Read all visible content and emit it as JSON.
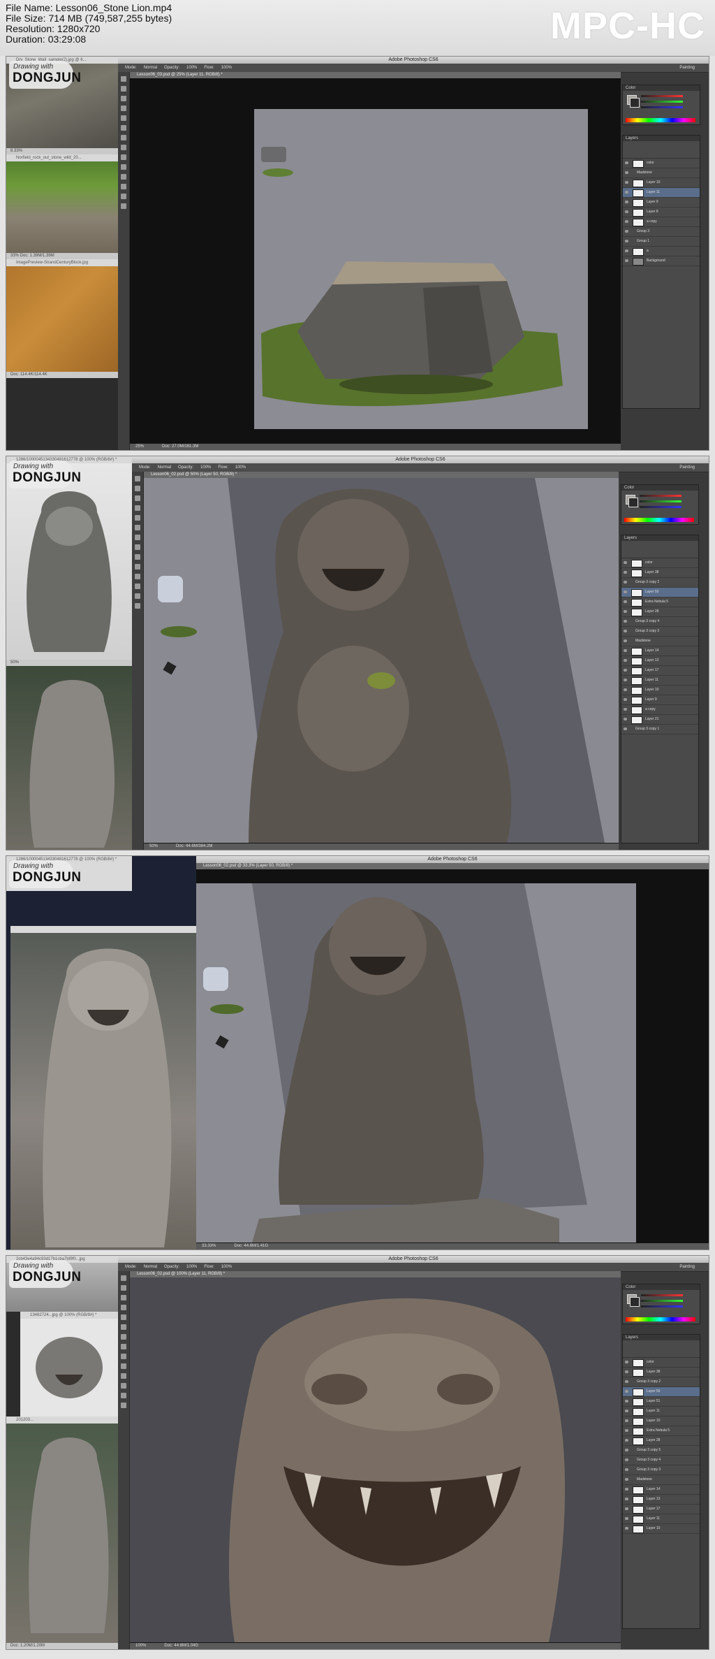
{
  "header": {
    "file_name_line": "File Name: Lesson06_Stone Lion.mp4",
    "file_size_line": "File Size: 714 MB (749,587,255 bytes)",
    "resolution_line": "Resolution: 1280x720",
    "duration_line": "Duration: 03:29:08",
    "player_logo": "MPC-HC"
  },
  "app": {
    "title": "Adobe Photoshop CS6",
    "workspace": "Painting",
    "options": [
      "Mode:",
      "Normal",
      "Opacity:",
      "100%",
      "Flow:",
      "100%"
    ]
  },
  "badge": {
    "script": "Drawing with",
    "name": "DONGJUN"
  },
  "frames": [
    {
      "doc_tab": "Lesson06_03.psd @ 25% (Layer 11, RGB/8) *",
      "zoom": "25%",
      "doc_size": "Doc: 27.0M/161.3M",
      "refs": [
        {
          "tab": "Dry_Stone_Wall_sample(2).jpg @ 6...",
          "status": "8.33%"
        },
        {
          "tab": "Norfield_rock_out_stone_wild_20...",
          "status": "33%   Doc: 1.39M/1.39M"
        },
        {
          "tab": "ImagePreview-StrandCenturyBlock.jpg",
          "status": "Doc: 114.4K/114.4K"
        }
      ],
      "layers": [
        "color",
        "Madstone",
        "Layer 10",
        "Layer 11",
        "Layer 9",
        "Layer 8",
        "a copy",
        "Group 3",
        "Group 1",
        "a",
        "Background"
      ]
    },
    {
      "doc_tab": "Lesson06_02.psd @ 50% (Layer 50, RGB/8) *",
      "zoom": "50%",
      "doc_size": "Doc: 44.6M/384.2M",
      "refs": [
        {
          "tab": "1286/1000045134330481612778 @ 100% (RGB/8#) *",
          "status": "50%"
        },
        {
          "tab": "",
          "status": ""
        }
      ],
      "layers": [
        "color",
        "Layer 38",
        "Group 3 copy 2",
        "Layer 50",
        "Extra Nebula 5",
        "Layer 28",
        "Group 3 copy 4",
        "Group 3 copy 3",
        "Madstone",
        "Layer 14",
        "Layer 13",
        "Layer 17",
        "Layer 11",
        "Layer 10",
        "Layer 9",
        "a copy",
        "Layer 21",
        "Group 3 copy 1"
      ]
    },
    {
      "doc_tab": "Lesson06_02.psd @ 33.3% (Layer 50, RGB/8) *",
      "zoom": "33.33%",
      "doc_size": "Doc: 44.6M/1.41G",
      "refs": [
        {
          "tab": "1286/1000045134330481612778 @ 100% (RGB/8#) *",
          "status": ""
        },
        {
          "tab": "",
          "status": ""
        }
      ],
      "layers": []
    },
    {
      "doc_tab": "Lesson06_02.psd @ 100% (Layer 11, RGB/8) *",
      "zoom": "100%",
      "doc_size": "Doc: 44.6M/1.04G",
      "refs": [
        {
          "tab": "2cb43e4a94c93d17b1cba7bf9f0...jpg",
          "status": ""
        },
        {
          "tab": "13482724...jpg @ 100% (RGB/8#) *",
          "status": ""
        },
        {
          "tab": "201203...",
          "status": "Doc: 1.20M/1.20M"
        }
      ],
      "layers": [
        "color",
        "Layer 38",
        "Group 3 copy 2",
        "Layer 50",
        "Layer 51",
        "Layer 11",
        "Layer 10",
        "Extra Nebula 5",
        "Layer 28",
        "Group 3 copy 5",
        "Group 3 copy 4",
        "Group 3 copy 3",
        "Madstone",
        "Layer 14",
        "Layer 13",
        "Layer 17",
        "Layer 11",
        "Layer 10"
      ]
    }
  ]
}
